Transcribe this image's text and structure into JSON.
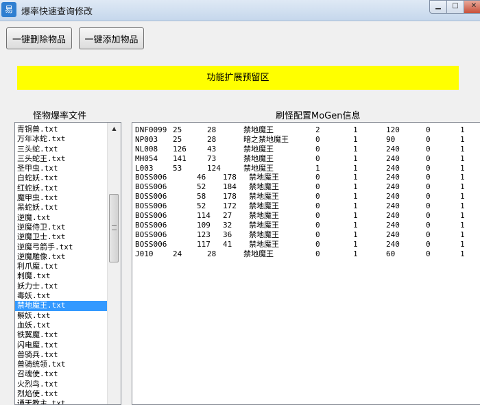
{
  "window": {
    "title": "爆率快速查询修改"
  },
  "toolbar": {
    "delete_label": "一键删除物品",
    "add_label": "一键添加物品"
  },
  "reserved_area": {
    "label": "功能扩展预留区"
  },
  "left_panel": {
    "label": "怪物爆率文件",
    "items": [
      "青铜兽.txt",
      "万年冰蛇.txt",
      "三头蛇.txt",
      "三头蛇王.txt",
      "圣甲虫.txt",
      "白蛇妖.txt",
      "红蛇妖.txt",
      "魔甲虫.txt",
      "黑蛇妖.txt",
      "逆魔.txt",
      "逆魔侍卫.txt",
      "逆魔卫士.txt",
      "逆魔弓箭手.txt",
      "逆魔雕像.txt",
      "利爪魔.txt",
      "刺魔.txt",
      "妖力士.txt",
      "毒妖.txt",
      "禁地魔王.txt",
      "鬃妖.txt",
      "血妖.txt",
      "铁翼魔.txt",
      "闪电魔.txt",
      "兽骑兵.txt",
      "兽骑统领.txt",
      "召魂使.txt",
      "火烈鸟.txt",
      "烈焰使.txt",
      "通天教主.txt"
    ],
    "selected_index": 18
  },
  "right_panel": {
    "label": "刷怪配置MoGen信息",
    "rows": [
      [
        "DNF0099",
        "25",
        "28",
        "禁地魔王",
        "2",
        "1",
        "120",
        "0",
        "1"
      ],
      [
        "NP003",
        "25",
        "28",
        "暗之禁地魔王",
        "0",
        "1",
        "90",
        "0",
        "1"
      ],
      [
        "NL008",
        "126",
        "43",
        "禁地魔王",
        "0",
        "1",
        "240",
        "0",
        "1"
      ],
      [
        "MH054",
        "141",
        "73",
        "禁地魔王",
        "0",
        "1",
        "240",
        "0",
        "1"
      ],
      [
        "L003",
        "53",
        "124",
        "禁地魔王",
        "1",
        "1",
        "240",
        "0",
        "1"
      ],
      [
        "BOSS006",
        "46",
        "178",
        "禁地魔王",
        "0",
        "1",
        "240",
        "0",
        "1"
      ],
      [
        "BOSS006",
        "52",
        "184",
        "禁地魔王",
        "0",
        "1",
        "240",
        "0",
        "1"
      ],
      [
        "BOSS006",
        "58",
        "178",
        "禁地魔王",
        "0",
        "1",
        "240",
        "0",
        "1"
      ],
      [
        "BOSS006",
        "52",
        "172",
        "禁地魔王",
        "0",
        "1",
        "240",
        "0",
        "1"
      ],
      [
        "BOSS006",
        "114",
        "27",
        "禁地魔王",
        "0",
        "1",
        "240",
        "0",
        "1"
      ],
      [
        "BOSS006",
        "109",
        "32",
        "禁地魔王",
        "0",
        "1",
        "240",
        "0",
        "1"
      ],
      [
        "BOSS006",
        "123",
        "36",
        "禁地魔王",
        "0",
        "1",
        "240",
        "0",
        "1"
      ],
      [
        "BOSS006",
        "117",
        "41",
        "禁地魔王",
        "0",
        "1",
        "240",
        "0",
        "1"
      ],
      [
        "J010",
        "24",
        "28",
        "禁地魔王",
        "0",
        "1",
        "60",
        "0",
        "1"
      ]
    ]
  }
}
